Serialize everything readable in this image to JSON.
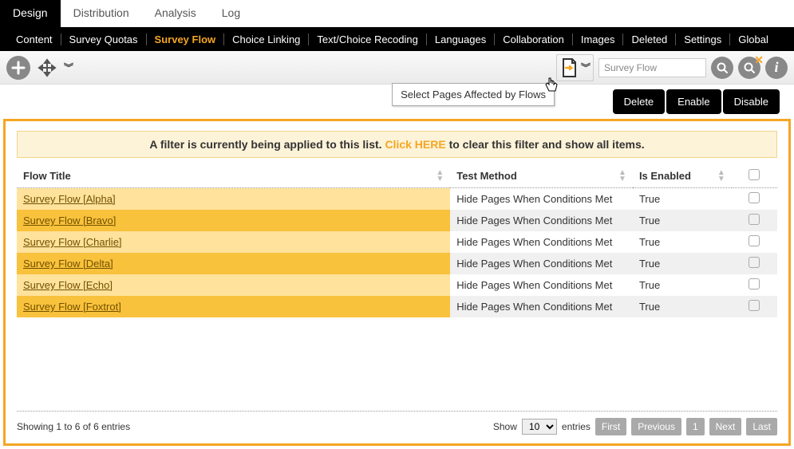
{
  "top_tabs": {
    "design": "Design",
    "distribution": "Distribution",
    "analysis": "Analysis",
    "log": "Log",
    "active": "design"
  },
  "sub_nav": {
    "items": [
      "Content",
      "Survey Quotas",
      "Survey Flow",
      "Choice Linking",
      "Text/Choice Recoding",
      "Languages",
      "Collaboration",
      "Images",
      "Deleted",
      "Settings",
      "Global"
    ],
    "active_index": 2
  },
  "toolbar": {
    "tooltip": "Select Pages Affected by Flows",
    "search_value": "Survey Flow"
  },
  "actions": {
    "delete": "Delete",
    "enable": "Enable",
    "disable": "Disable"
  },
  "filter_banner": {
    "prefix": "A filter is currently being applied to this list. ",
    "link": "Click HERE",
    "suffix": " to clear this filter and show all items."
  },
  "table": {
    "headers": {
      "flow_title": "Flow Title",
      "test_method": "Test Method",
      "is_enabled": "Is Enabled"
    },
    "rows": [
      {
        "title": "Survey Flow [Alpha]",
        "method": "Hide Pages When Conditions Met",
        "enabled": "True"
      },
      {
        "title": "Survey Flow [Bravo]",
        "method": "Hide Pages When Conditions Met",
        "enabled": "True"
      },
      {
        "title": "Survey Flow [Charlie]",
        "method": "Hide Pages When Conditions Met",
        "enabled": "True"
      },
      {
        "title": "Survey Flow [Delta]",
        "method": "Hide Pages When Conditions Met",
        "enabled": "True"
      },
      {
        "title": "Survey Flow [Echo]",
        "method": "Hide Pages When Conditions Met",
        "enabled": "True"
      },
      {
        "title": "Survey Flow [Foxtrot]",
        "method": "Hide Pages When Conditions Met",
        "enabled": "True"
      }
    ]
  },
  "footer": {
    "showing": "Showing 1 to 6 of 6 entries",
    "show_label": "Show",
    "entries_label": "entries",
    "page_size": "10",
    "first": "First",
    "previous": "Previous",
    "page": "1",
    "next": "Next",
    "last": "Last"
  }
}
